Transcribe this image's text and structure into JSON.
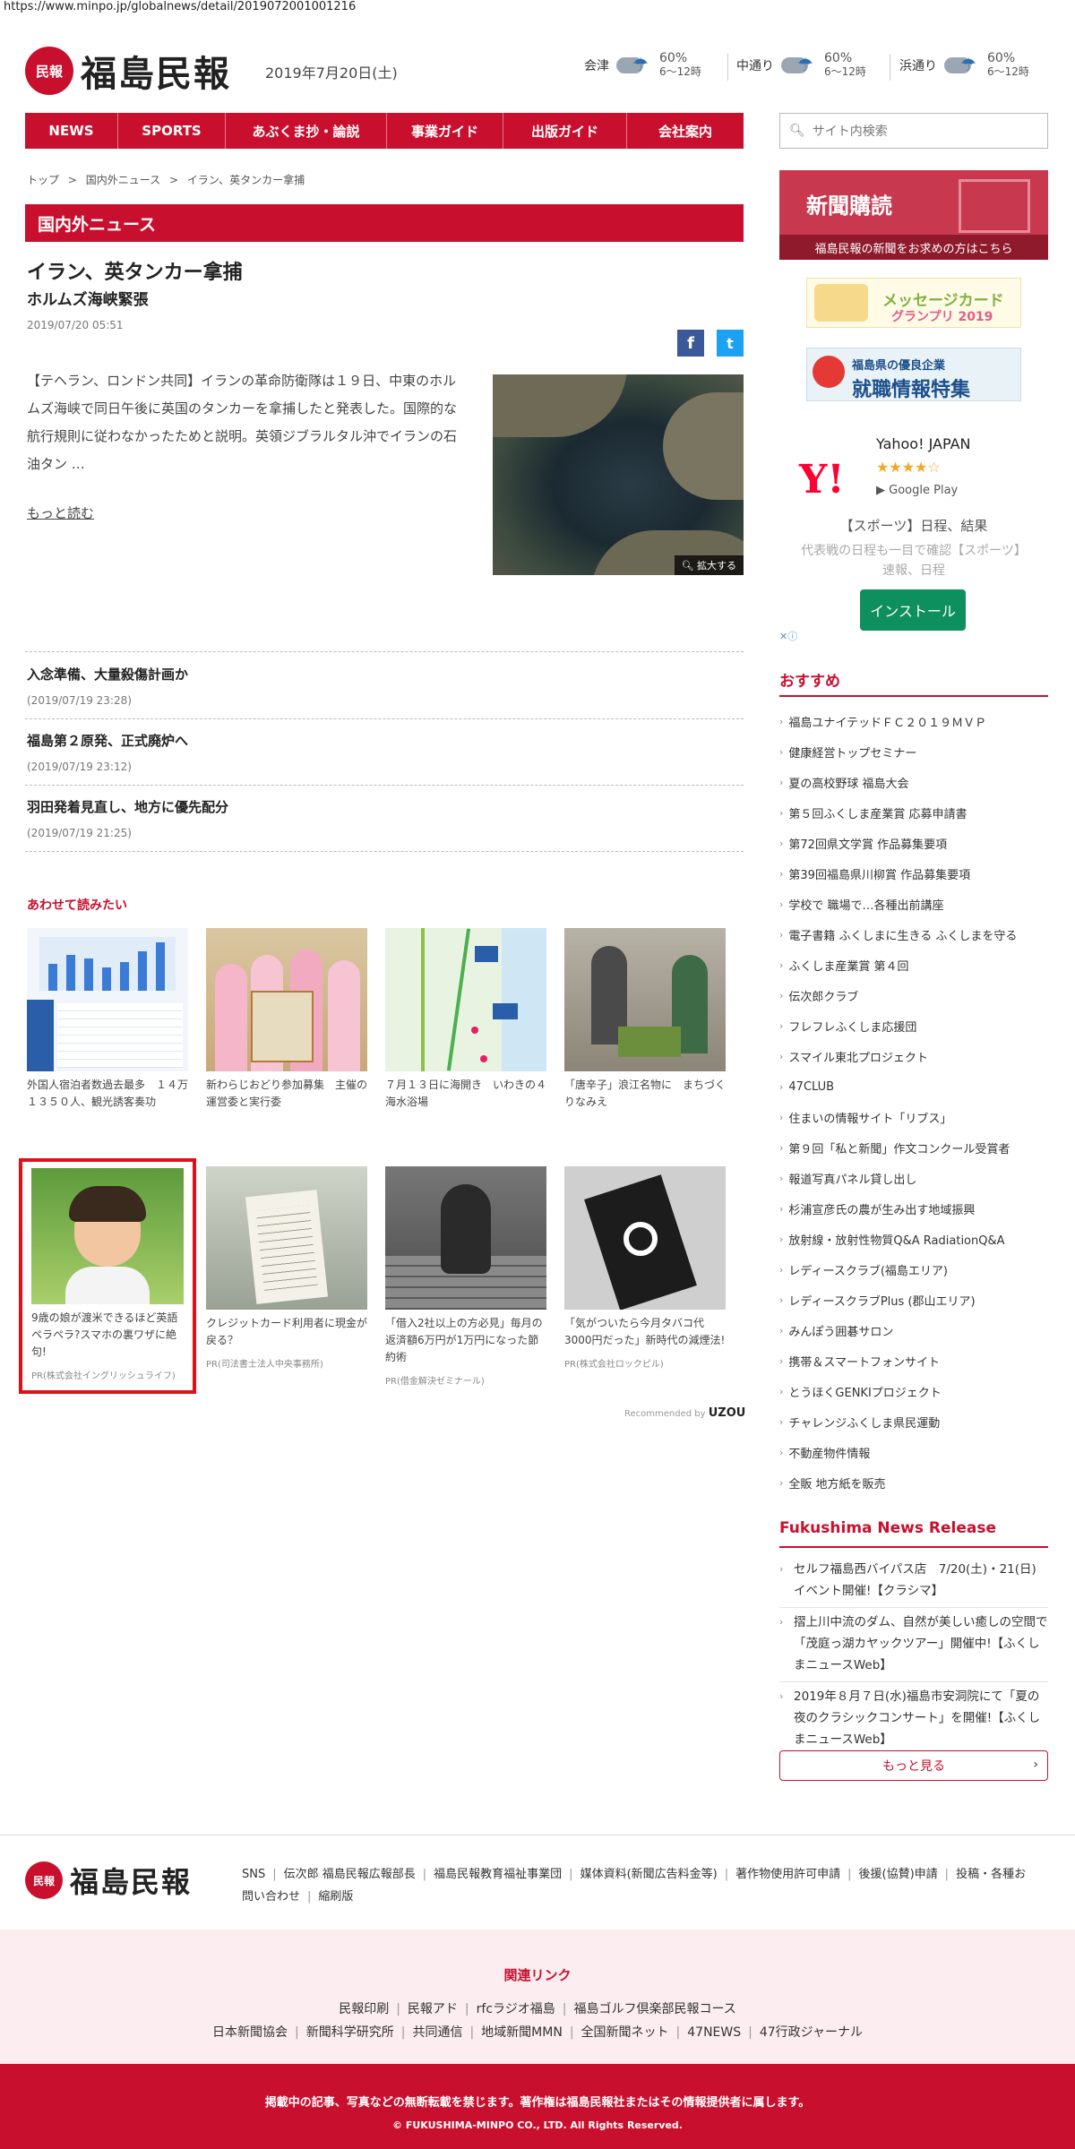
{
  "browser": {
    "url": "https://www.minpo.jp/globalnews/detail/2019072001001216"
  },
  "header": {
    "logo_seal": "民報",
    "logo_text": "福島民報",
    "date": "2019年7月20日(土)",
    "weather": [
      {
        "city": "会津",
        "pct": "60%",
        "time": "6〜12時",
        "icon": "cloud-umbrella-icon"
      },
      {
        "city": "中通り",
        "pct": "60%",
        "time": "6〜12時",
        "icon": "cloud-umbrella-icon"
      },
      {
        "city": "浜通り",
        "pct": "60%",
        "time": "6〜12時",
        "icon": "cloud-umbrella-icon"
      }
    ]
  },
  "nav": [
    "NEWS",
    "SPORTS",
    "あぶくま抄・論説",
    "事業ガイド",
    "出版ガイド",
    "会社案内"
  ],
  "search": {
    "placeholder": "サイト内検索"
  },
  "breadcrumb": [
    "トップ",
    "国内外ニュース",
    "イラン、英タンカー拿捕"
  ],
  "section_title": "国内外ニュース",
  "article": {
    "title": "イラン、英タンカー拿捕",
    "subtitle": "ホルムズ海峡緊張",
    "date": "2019/07/20 05:51",
    "body": "【テヘラン、ロンドン共同】イランの革命防衛隊は１９日、中東のホルムズ海峡で同日午後に英国のタンカーを拿捕したと発表した。国際的な航行規則に従わなかったためと説明。英領ジブラルタル沖でイランの石油タン …",
    "more": "もっと読む",
    "zoom": "拡大する"
  },
  "related_news": [
    {
      "title": "入念準備、大量殺傷計画か",
      "date": "(2019/07/19 23:28)"
    },
    {
      "title": "福島第２原発、正式廃炉へ",
      "date": "(2019/07/19 23:12)"
    },
    {
      "title": "羽田発着見直し、地方に優先配分",
      "date": "(2019/07/19 21:25)"
    }
  ],
  "also_read": {
    "heading": "あわせて読みたい",
    "items": [
      {
        "caption": "外国人宿泊者数過去最多　１４万１３５０人、観光誘客奏功",
        "pr": ""
      },
      {
        "caption": "新わらじおどり参加募集　主催の運営委と実行委",
        "pr": ""
      },
      {
        "caption": "７月１３日に海開き　いわきの４海水浴場",
        "pr": ""
      },
      {
        "caption": "「唐辛子」浪江名物に　まちづくりなみえ",
        "pr": ""
      },
      {
        "caption": "9歳の娘が渡米できるほど英語ペラペラ?スマホの裏ワザに絶句!",
        "pr": "PR(株式会社イングリッシュライフ)"
      },
      {
        "caption": "クレジットカード利用者に現金が戻る？",
        "pr": "PR(司法書士法人中央事務所)"
      },
      {
        "caption": "「借入2社以上の方必見」毎月の返済額6万円が1万円になった節約術",
        "pr": "PR(借金解決ゼミナール)"
      },
      {
        "caption": "「気がついたら今月タバコ代3000円だった」新時代の減煙法!",
        "pr": "PR(株式会社ロックピル)"
      }
    ],
    "recommended": "Recommended by",
    "recommended_brand": "UZOU"
  },
  "sidebar": {
    "subscribe": {
      "title": "新聞購読",
      "sub": "福島民報の新聞をお求めの方はこちら"
    },
    "banner_message": {
      "title": "メッセージカード",
      "sub": "グランプリ 2019"
    },
    "banner_jobs": {
      "title": "福島県の優良企業",
      "sub": "就職情報特集"
    },
    "ad": {
      "name": "Yahoo! JAPAN",
      "logo": "Y!",
      "stars": "★★★★☆",
      "store": "Google Play",
      "line1": "【スポーツ】日程、結果",
      "line2": "代表戦の日程も一目で確認【スポーツ】速報、日程",
      "button": "インストール"
    },
    "recommended_heading": "おすすめ",
    "recommended": [
      "福島ユナイテッドＦＣ２０１９ＭＶＰ",
      "健康経営トップセミナー",
      "夏の高校野球 福島大会",
      "第５回ふくしま産業賞 応募申請書",
      "第72回県文学賞 作品募集要項",
      "第39回福島県川柳賞 作品募集要項",
      "学校で 職場で…各種出前講座",
      "電子書籍 ふくしまに生きる ふくしまを守る",
      "ふくしま産業賞 第４回",
      "伝次郎クラブ",
      "フレフレふくしま応援団",
      "スマイル東北プロジェクト",
      "47CLUB",
      "住まいの情報サイト「リブス」",
      "第９回「私と新聞」作文コンクール受賞者",
      "報道写真パネル貸し出し",
      "杉浦宣彦氏の農が生み出す地域振興",
      "放射線・放射性物質Q&A RadiationQ&A",
      "レディースクラブ(福島エリア)",
      "レディースクラブPlus (郡山エリア)",
      "みんぽう囲碁サロン",
      "携帯＆スマートフォンサイト",
      "とうほくGENKIプロジェクト",
      "チャレンジふくしま県民運動",
      "不動産物件情報",
      "全販 地方紙を販売"
    ],
    "news_release_heading": "Fukushima News Release",
    "news_release": [
      "セルフ福島西バイパス店　7/20(土)・21(日)イベント開催!【クラシマ】",
      "摺上川中流のダム、自然が美しい癒しの空間で「茂庭っ湖カヤックツアー」開催中!【ふくしまニュースWeb】",
      "2019年８月７日(水)福島市安洞院にて「夏の夜のクラシックコンサート」を開催!【ふくしまニュースWeb】"
    ],
    "more_button": "もっと見る"
  },
  "footer": {
    "links": [
      "SNS",
      "伝次郎 福島民報広報部長",
      "福島民報教育福祉事業団",
      "媒体資料(新聞広告料金等)",
      "著作物使用許可申請",
      "後援(協賛)申請",
      "投稿・各種お問い合わせ",
      "縮刷版"
    ],
    "related_heading": "関連リンク",
    "related_row1": [
      "民報印刷",
      "民報アド",
      "rfcラジオ福島",
      "福島ゴルフ倶楽部民報コース"
    ],
    "related_row2": [
      "日本新聞協会",
      "新聞科学研究所",
      "共同通信",
      "地域新聞MMN",
      "全国新聞ネット",
      "47NEWS",
      "47行政ジャーナル"
    ],
    "copyright_notice": "掲載中の記事、写真などの無断転載を禁じます。著作権は福島民報社またはその情報提供者に属します。",
    "copyright": "© FUKUSHIMA-MINPO CO., LTD. All Rights Reserved."
  }
}
